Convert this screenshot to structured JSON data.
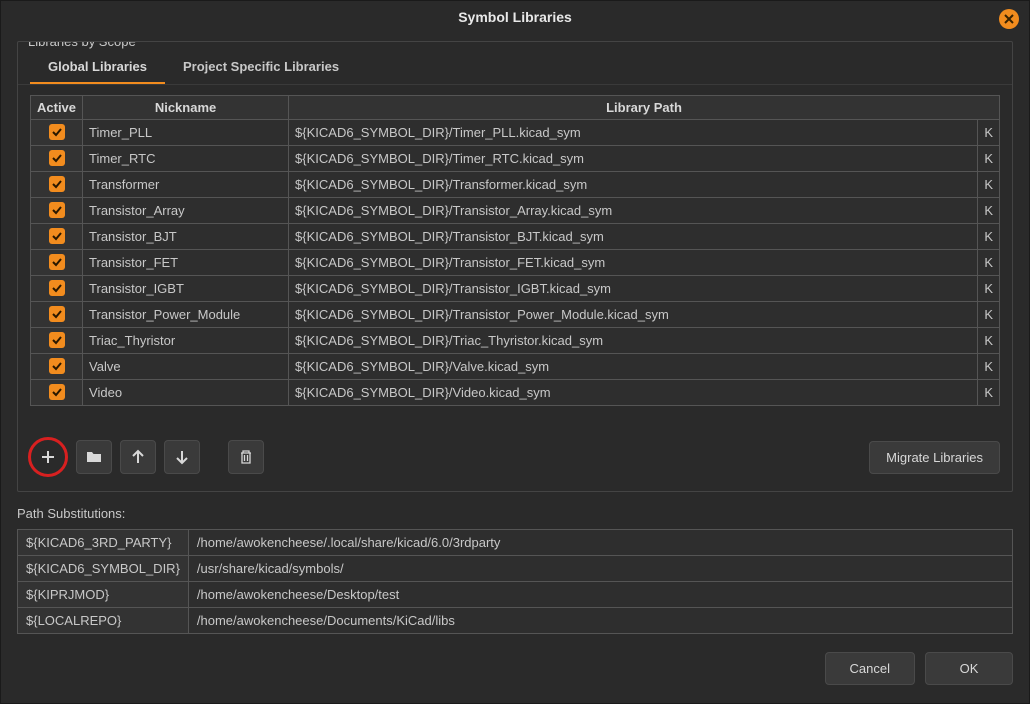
{
  "title": "Symbol Libraries",
  "fieldset_label": "Libraries by Scope",
  "tabs": {
    "global": "Global Libraries",
    "project": "Project Specific Libraries"
  },
  "columns": {
    "active": "Active",
    "nickname": "Nickname",
    "path": "Library Path"
  },
  "rows": [
    {
      "nickname": "Timer_PLL",
      "path": "${KICAD6_SYMBOL_DIR}/Timer_PLL.kicad_sym",
      "extra": "K"
    },
    {
      "nickname": "Timer_RTC",
      "path": "${KICAD6_SYMBOL_DIR}/Timer_RTC.kicad_sym",
      "extra": "K"
    },
    {
      "nickname": "Transformer",
      "path": "${KICAD6_SYMBOL_DIR}/Transformer.kicad_sym",
      "extra": "K"
    },
    {
      "nickname": "Transistor_Array",
      "path": "${KICAD6_SYMBOL_DIR}/Transistor_Array.kicad_sym",
      "extra": "K"
    },
    {
      "nickname": "Transistor_BJT",
      "path": "${KICAD6_SYMBOL_DIR}/Transistor_BJT.kicad_sym",
      "extra": "K"
    },
    {
      "nickname": "Transistor_FET",
      "path": "${KICAD6_SYMBOL_DIR}/Transistor_FET.kicad_sym",
      "extra": "K"
    },
    {
      "nickname": "Transistor_IGBT",
      "path": "${KICAD6_SYMBOL_DIR}/Transistor_IGBT.kicad_sym",
      "extra": "K"
    },
    {
      "nickname": "Transistor_Power_Module",
      "path": "${KICAD6_SYMBOL_DIR}/Transistor_Power_Module.kicad_sym",
      "extra": "K"
    },
    {
      "nickname": "Triac_Thyristor",
      "path": "${KICAD6_SYMBOL_DIR}/Triac_Thyristor.kicad_sym",
      "extra": "K"
    },
    {
      "nickname": "Valve",
      "path": "${KICAD6_SYMBOL_DIR}/Valve.kicad_sym",
      "extra": "K"
    },
    {
      "nickname": "Video",
      "path": "${KICAD6_SYMBOL_DIR}/Video.kicad_sym",
      "extra": "K"
    }
  ],
  "migrate_label": "Migrate Libraries",
  "path_subs_label": "Path Substitutions:",
  "path_subs": [
    {
      "var": "${KICAD6_3RD_PARTY}",
      "val": "/home/awokencheese/.local/share/kicad/6.0/3rdparty"
    },
    {
      "var": "${KICAD6_SYMBOL_DIR}",
      "val": "/usr/share/kicad/symbols/"
    },
    {
      "var": "${KIPRJMOD}",
      "val": "/home/awokencheese/Desktop/test"
    },
    {
      "var": "${LOCALREPO}",
      "val": "/home/awokencheese/Documents/KiCad/libs"
    }
  ],
  "buttons": {
    "cancel": "Cancel",
    "ok": "OK"
  }
}
